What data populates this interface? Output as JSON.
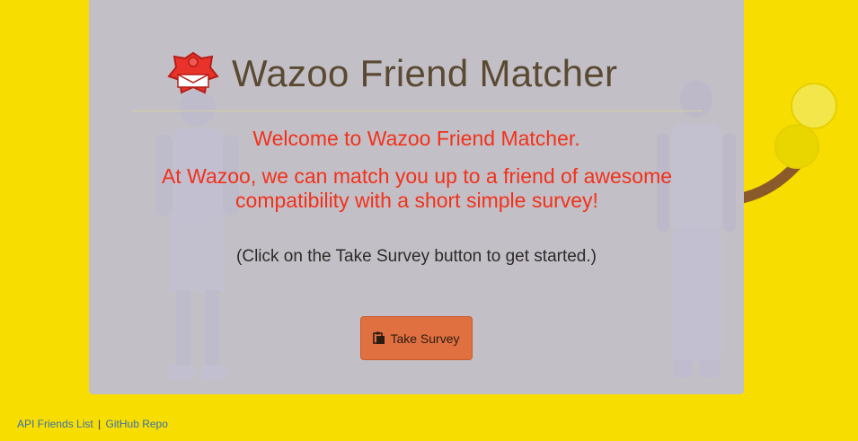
{
  "app": {
    "title": "Wazoo Friend Matcher"
  },
  "main": {
    "welcome": "Welcome to Wazoo Friend Matcher.",
    "pitch": "At Wazoo, we can match you up to a friend of awesome compatibility with a short simple survey!",
    "instruction": "(Click on the Take Survey button to get started.)",
    "survey_button": {
      "label": "Take Survey",
      "icon": "clipboard-icon"
    }
  },
  "footer": {
    "links": [
      {
        "label": "API Friends List"
      },
      {
        "label": "GitHub Repo"
      }
    ],
    "separator": "|"
  },
  "colors": {
    "page_background": "#f7dd00",
    "panel": "#bebcd6",
    "accent_text": "#f2311a",
    "title_text": "#5a4a32",
    "button": "#e07040"
  }
}
